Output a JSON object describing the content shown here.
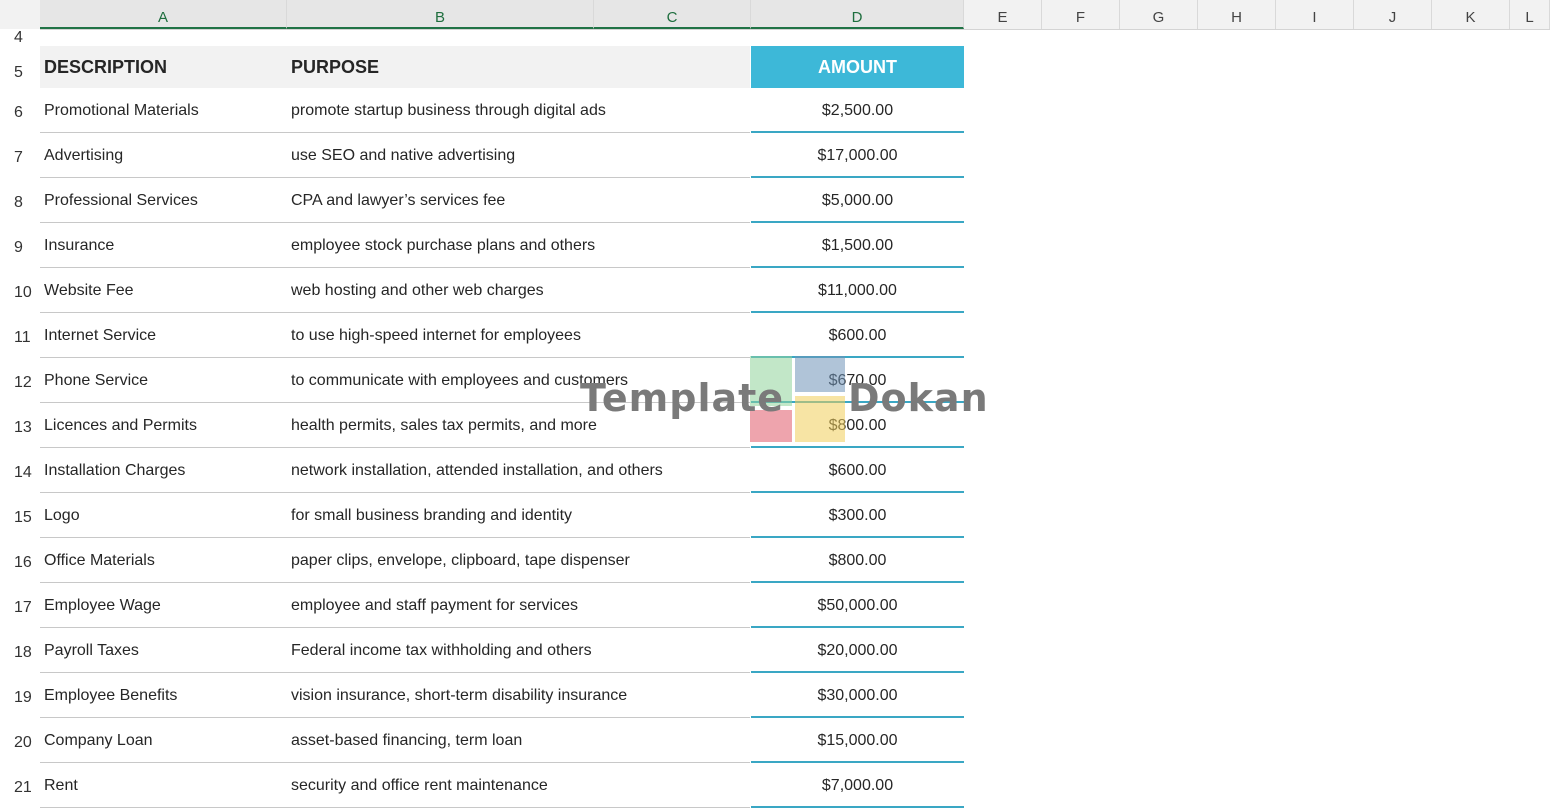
{
  "columns": [
    "A",
    "B",
    "C",
    "D",
    "E",
    "F",
    "G",
    "H",
    "I",
    "J",
    "K",
    "L"
  ],
  "rows": [
    "4",
    "5",
    "6",
    "7",
    "8",
    "9",
    "10",
    "11",
    "12",
    "13",
    "14",
    "15",
    "16",
    "17",
    "18",
    "19",
    "20",
    "21"
  ],
  "table": {
    "headers": {
      "description": "DESCRIPTION",
      "purpose": "PURPOSE",
      "amount": "AMOUNT"
    },
    "items": [
      {
        "description": "Promotional Materials",
        "purpose": "promote startup business through digital ads",
        "amount": "$2,500.00"
      },
      {
        "description": "Advertising",
        "purpose": "use SEO and native advertising",
        "amount": "$17,000.00"
      },
      {
        "description": "Professional Services",
        "purpose": "CPA and lawyer’s services fee",
        "amount": "$5,000.00"
      },
      {
        "description": "Insurance",
        "purpose": "employee stock purchase plans and others",
        "amount": "$1,500.00"
      },
      {
        "description": "Website Fee",
        "purpose": "web hosting and other web charges",
        "amount": "$11,000.00"
      },
      {
        "description": "Internet Service",
        "purpose": "to use high-speed internet for employees",
        "amount": "$600.00"
      },
      {
        "description": "Phone Service",
        "purpose": "to communicate with employees and customers",
        "amount": "$670.00"
      },
      {
        "description": "Licences and Permits",
        "purpose": "health permits, sales tax permits, and more",
        "amount": "$800.00"
      },
      {
        "description": "Installation Charges",
        "purpose": "network installation, attended installation, and others",
        "amount": "$600.00"
      },
      {
        "description": "Logo",
        "purpose": "for small business branding and identity",
        "amount": "$300.00"
      },
      {
        "description": "Office Materials",
        "purpose": "paper clips, envelope, clipboard, tape dispenser",
        "amount": "$800.00"
      },
      {
        "description": "Employee Wage",
        "purpose": "employee and staff payment for services",
        "amount": "$50,000.00"
      },
      {
        "description": "Payroll Taxes",
        "purpose": "Federal income tax withholding and others",
        "amount": "$20,000.00"
      },
      {
        "description": "Employee Benefits",
        "purpose": "vision insurance, short-term disability insurance",
        "amount": "$30,000.00"
      },
      {
        "description": "Company Loan",
        "purpose": "asset-based financing, term loan",
        "amount": "$15,000.00"
      },
      {
        "description": "Rent",
        "purpose": "security and office rent maintenance",
        "amount": "$7,000.00"
      }
    ]
  },
  "watermark": {
    "word1": "Template",
    "word2": "Dokan"
  },
  "colors": {
    "accent": "#3db8d8",
    "amount_line": "#3aa7c4",
    "header_band": "#f2f2f2"
  }
}
